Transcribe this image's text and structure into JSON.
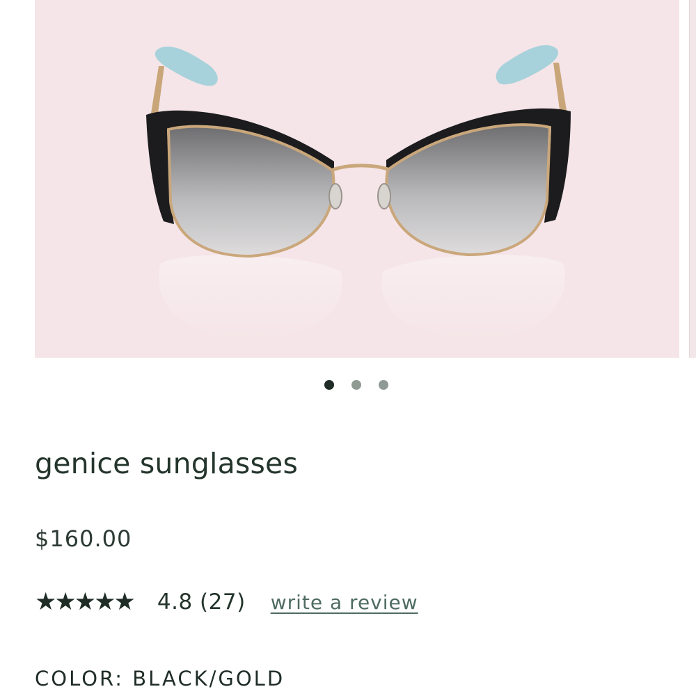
{
  "carousel": {
    "image": "product-image-sunglasses",
    "slide_count": 3,
    "active_index": 0,
    "colors": {
      "background": "#f5e5e8",
      "frame": "#1c1c1e",
      "metal": "#caa77b",
      "tips": "#a9d3dc",
      "dot_active": "#1f2d26",
      "dot_inactive": "#8f9a95"
    }
  },
  "product": {
    "name": "genice sunglasses",
    "price": "$160.00"
  },
  "rating": {
    "stars": "★★★★★",
    "value": 4.8,
    "summary": "4.8 (27)",
    "review_link": "write a review"
  },
  "color": {
    "label": "COLOR:",
    "value": "BLACK/GOLD"
  }
}
